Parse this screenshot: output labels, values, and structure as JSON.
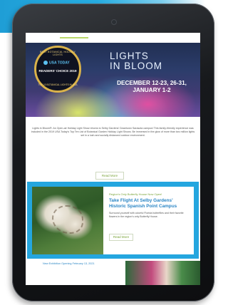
{
  "hero": {
    "badge": {
      "ring_text": "BEST BOTANICAL HOLIDAY LIGHTS",
      "logo": "USA TODAY",
      "choice_lines": "READERS' CHOICE 2019",
      "bottom_text": "TOP 10 BOTANICAL LIGHTS IN USA"
    },
    "title": "LIGHTS\nIN BLOOM",
    "dates": "DECEMBER 12-23, 26-31,\nJANUARY 1-2"
  },
  "intro": {
    "text": "Lights in Bloom®: An Open-air Holiday Light Show returns to Selby Gardens' Downtown Sarasota campus! This family-friendly experience was included in the 2019 USA Today's Top Ten List of Botanical Garden Holiday Light Shows. Be immersed in the glow of more than two million lights set in a lush and socially distanced outdoor environment.",
    "read_more": "Read More"
  },
  "feature": {
    "kicker": "Region's Only Butterfly House Now Open!",
    "title": "Take Flight At Selby Gardens'\nHistoric Spanish Point Campus",
    "text": "Surround yourself with colorful Florida butterflies and their favorite flowers in the region's only Butterfly House.",
    "read_more": "Read More"
  },
  "next_story": {
    "text": "New Exhibition Opening February 13, 2021"
  },
  "colors": {
    "accent_blue": "#24a6df",
    "link_blue": "#2b86c5",
    "button_green": "#7aa43a"
  }
}
